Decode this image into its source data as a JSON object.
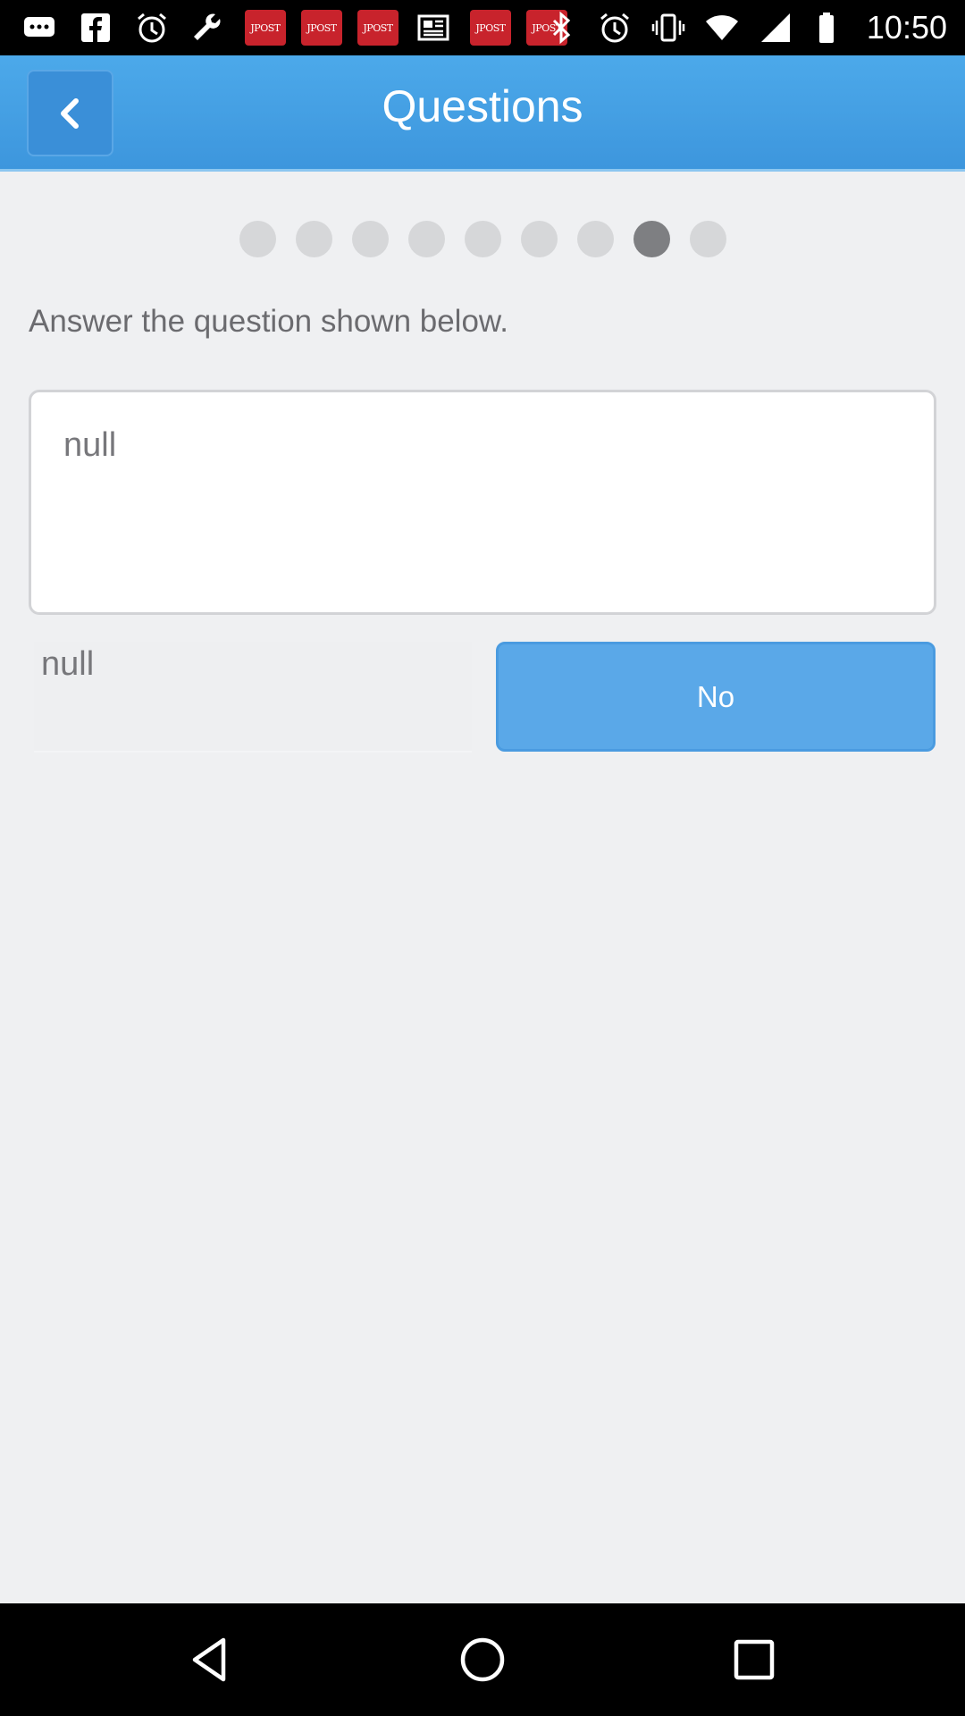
{
  "status_bar": {
    "time": "10:50",
    "jpost_label": "JPOST",
    "left_icons": [
      "messages-icon",
      "facebook-icon",
      "alarm-icon",
      "wrench-icon",
      "jpost-icon",
      "jpost-icon",
      "jpost-icon",
      "news-icon",
      "jpost-icon",
      "jpost-icon"
    ],
    "right_icons": [
      "bluetooth-icon",
      "alarm-icon",
      "vibrate-icon",
      "wifi-icon",
      "signal-icon",
      "battery-icon"
    ]
  },
  "header": {
    "title": "Questions"
  },
  "progress": {
    "total_steps": 9,
    "current_step": 8
  },
  "main": {
    "instruction": "Answer the question shown below.",
    "question_text": "null",
    "answer_text": "null",
    "no_button_label": "No"
  },
  "colors": {
    "header_blue": "#3d96dd",
    "button_blue": "#5aa8e8",
    "background": "#eff0f2",
    "dot_active": "#7e7f82",
    "dot_inactive": "#d6d7d9"
  }
}
